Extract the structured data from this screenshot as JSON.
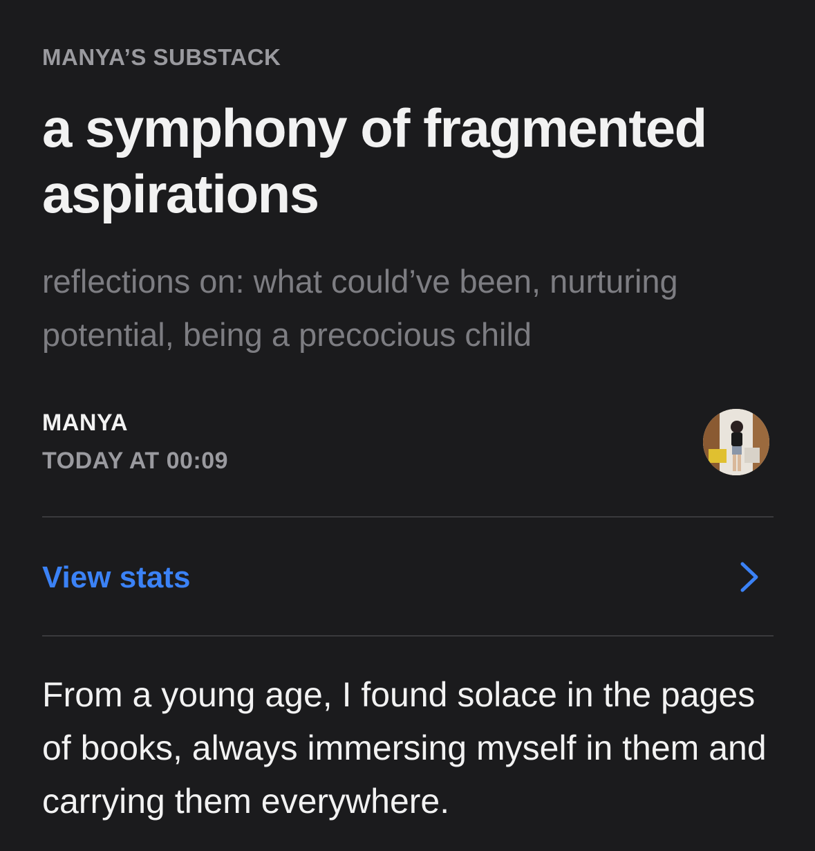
{
  "publication": {
    "name": "MANYA’S SUBSTACK"
  },
  "post": {
    "title": "a symphony of fragmented aspirations",
    "subtitle": "reflections on: what could’ve been, nurturing potential, being a precocious child",
    "author": "MANYA",
    "date": "TODAY AT 00:09",
    "body": "From a young age, I found solace in the pages of books, always immersing myself in them and carrying them everywhere."
  },
  "stats": {
    "label": "View stats",
    "icon": "chevron-right-icon"
  },
  "colors": {
    "background": "#1b1b1d",
    "accent": "#3b82f6",
    "muted": "#9a9a9f"
  }
}
